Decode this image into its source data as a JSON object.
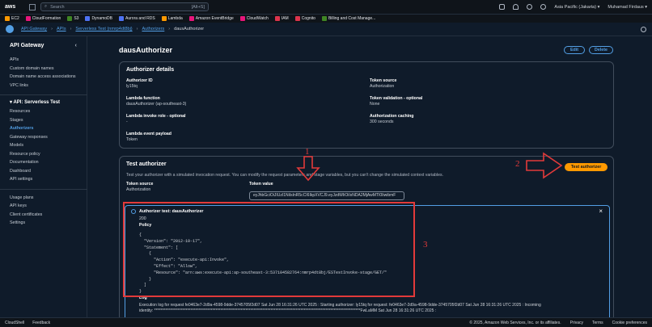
{
  "topbar": {
    "logo": "aws",
    "search_placeholder": "Search",
    "search_shortcut": "[Alt+S]",
    "region": "Asia Pacific (Jakarta) ▾",
    "user": "Muhamad Firdaus ▾"
  },
  "favorites": [
    {
      "label": "EC2",
      "color": "#ff9900"
    },
    {
      "label": "CloudFormation",
      "color": "#e7157b"
    },
    {
      "label": "S3",
      "color": "#3f8624"
    },
    {
      "label": "DynamoDB",
      "color": "#4d72f3"
    },
    {
      "label": "Aurora and RDS",
      "color": "#4d72f3"
    },
    {
      "label": "Lambda",
      "color": "#ff9900"
    },
    {
      "label": "Amazon EventBridge",
      "color": "#e7157b"
    },
    {
      "label": "CloudWatch",
      "color": "#e7157b"
    },
    {
      "label": "IAM",
      "color": "#dd344c"
    },
    {
      "label": "Cognito",
      "color": "#dd344c"
    },
    {
      "label": "Billing and Cost Manage...",
      "color": "#3f8624"
    }
  ],
  "breadcrumb": [
    "API Gateway",
    "APIs",
    "Serverless Test (nmrp4dt8bj)",
    "Authorizers",
    "dausAuthorizer"
  ],
  "sidebar": {
    "title": "API Gateway",
    "top_items": [
      "APIs",
      "Custom domain names",
      "Domain name access associations",
      "VPC links"
    ],
    "section": "API: Serverless Test",
    "api_items": [
      "Resources",
      "Stages",
      "Authorizers",
      "Gateway responses",
      "Models",
      "Resource policy",
      "Documentation",
      "Dashboard",
      "API settings"
    ],
    "bottom_items": [
      "Usage plans",
      "API keys",
      "Client certificates",
      "Settings"
    ]
  },
  "page": {
    "title": "dausAuthorizer",
    "edit_label": "Edit",
    "delete_label": "Delete"
  },
  "details": {
    "title": "Authorizer details",
    "authorizer_id_label": "Authorizer ID",
    "authorizer_id": "ly15tq",
    "lambda_function_label": "Lambda function",
    "lambda_function": "dausAuthorizer (ap-southeast-3)",
    "invoke_role_label": "Lambda invoke role - optional",
    "invoke_role": "-",
    "event_payload_label": "Lambda event payload",
    "event_payload": "Token",
    "token_source_label": "Token source",
    "token_source": "Authorization",
    "token_validation_label": "Token validation - optional",
    "token_validation": "None",
    "caching_label": "Authorization caching",
    "caching": "300 seconds"
  },
  "test": {
    "title": "Test authorizer",
    "description": "Test your authorizer with a simulated invocation request. You can modify the request parameters and stage variables, but you can't change the simulated context variables.",
    "button_label": "Test authorizer",
    "token_source_label": "Token source",
    "token_source": "Authorization",
    "token_value_label": "Token value",
    "token_value": "eyJhbGciOiJIUzI1NiIsInR5cCI6IkpXVCJ9.eyJzdWIiOiIxNDA2MjAwMTI0IiwibmF"
  },
  "result": {
    "title": "Authorizer test: dausAuthorizer",
    "status": "200",
    "policy_label": "Policy",
    "policy_code": "{\n  \"Version\": \"2012-10-17\",\n  \"Statement\": [\n    {\n      \"Action\": \"execute-api:Invoke\",\n      \"Effect\": \"Allow\",\n      \"Resource\": \"arn:aws:execute-api:ap-southeast-3:537104582764:nmrp4dt8bj/ESTestInvoke-stage/GET/\"\n    }\n  ]\n}",
    "log_label": "Log",
    "log_text": "Execution log for request fe0463e7-2d9a-4598-9dde-3745705f2d07 Sat Jun 28 16:31:26 UTC 2025 : Starting authorizer: ly15tq for request: fe0463e7-2d9a-4598-9dde-3745705f2d07 Sat Jun 28 16:31:26 UTC 2025 : Incoming\nidentity: ***********************************************************************************************************************************FwLaMM Sat Jun 28 16:31:26 UTC 2025 :"
  },
  "annotations": [
    "1",
    "2",
    "3"
  ],
  "footer": {
    "cloudshell": "CloudShell",
    "feedback": "Feedback",
    "copyright": "© 2025, Amazon Web Services, Inc. or its affiliates.",
    "privacy": "Privacy",
    "terms": "Terms",
    "cookies": "Cookie preferences"
  },
  "colors": {
    "accent": "#539fe5",
    "primary_button": "#ff9900",
    "annotation": "#e23a3a"
  }
}
